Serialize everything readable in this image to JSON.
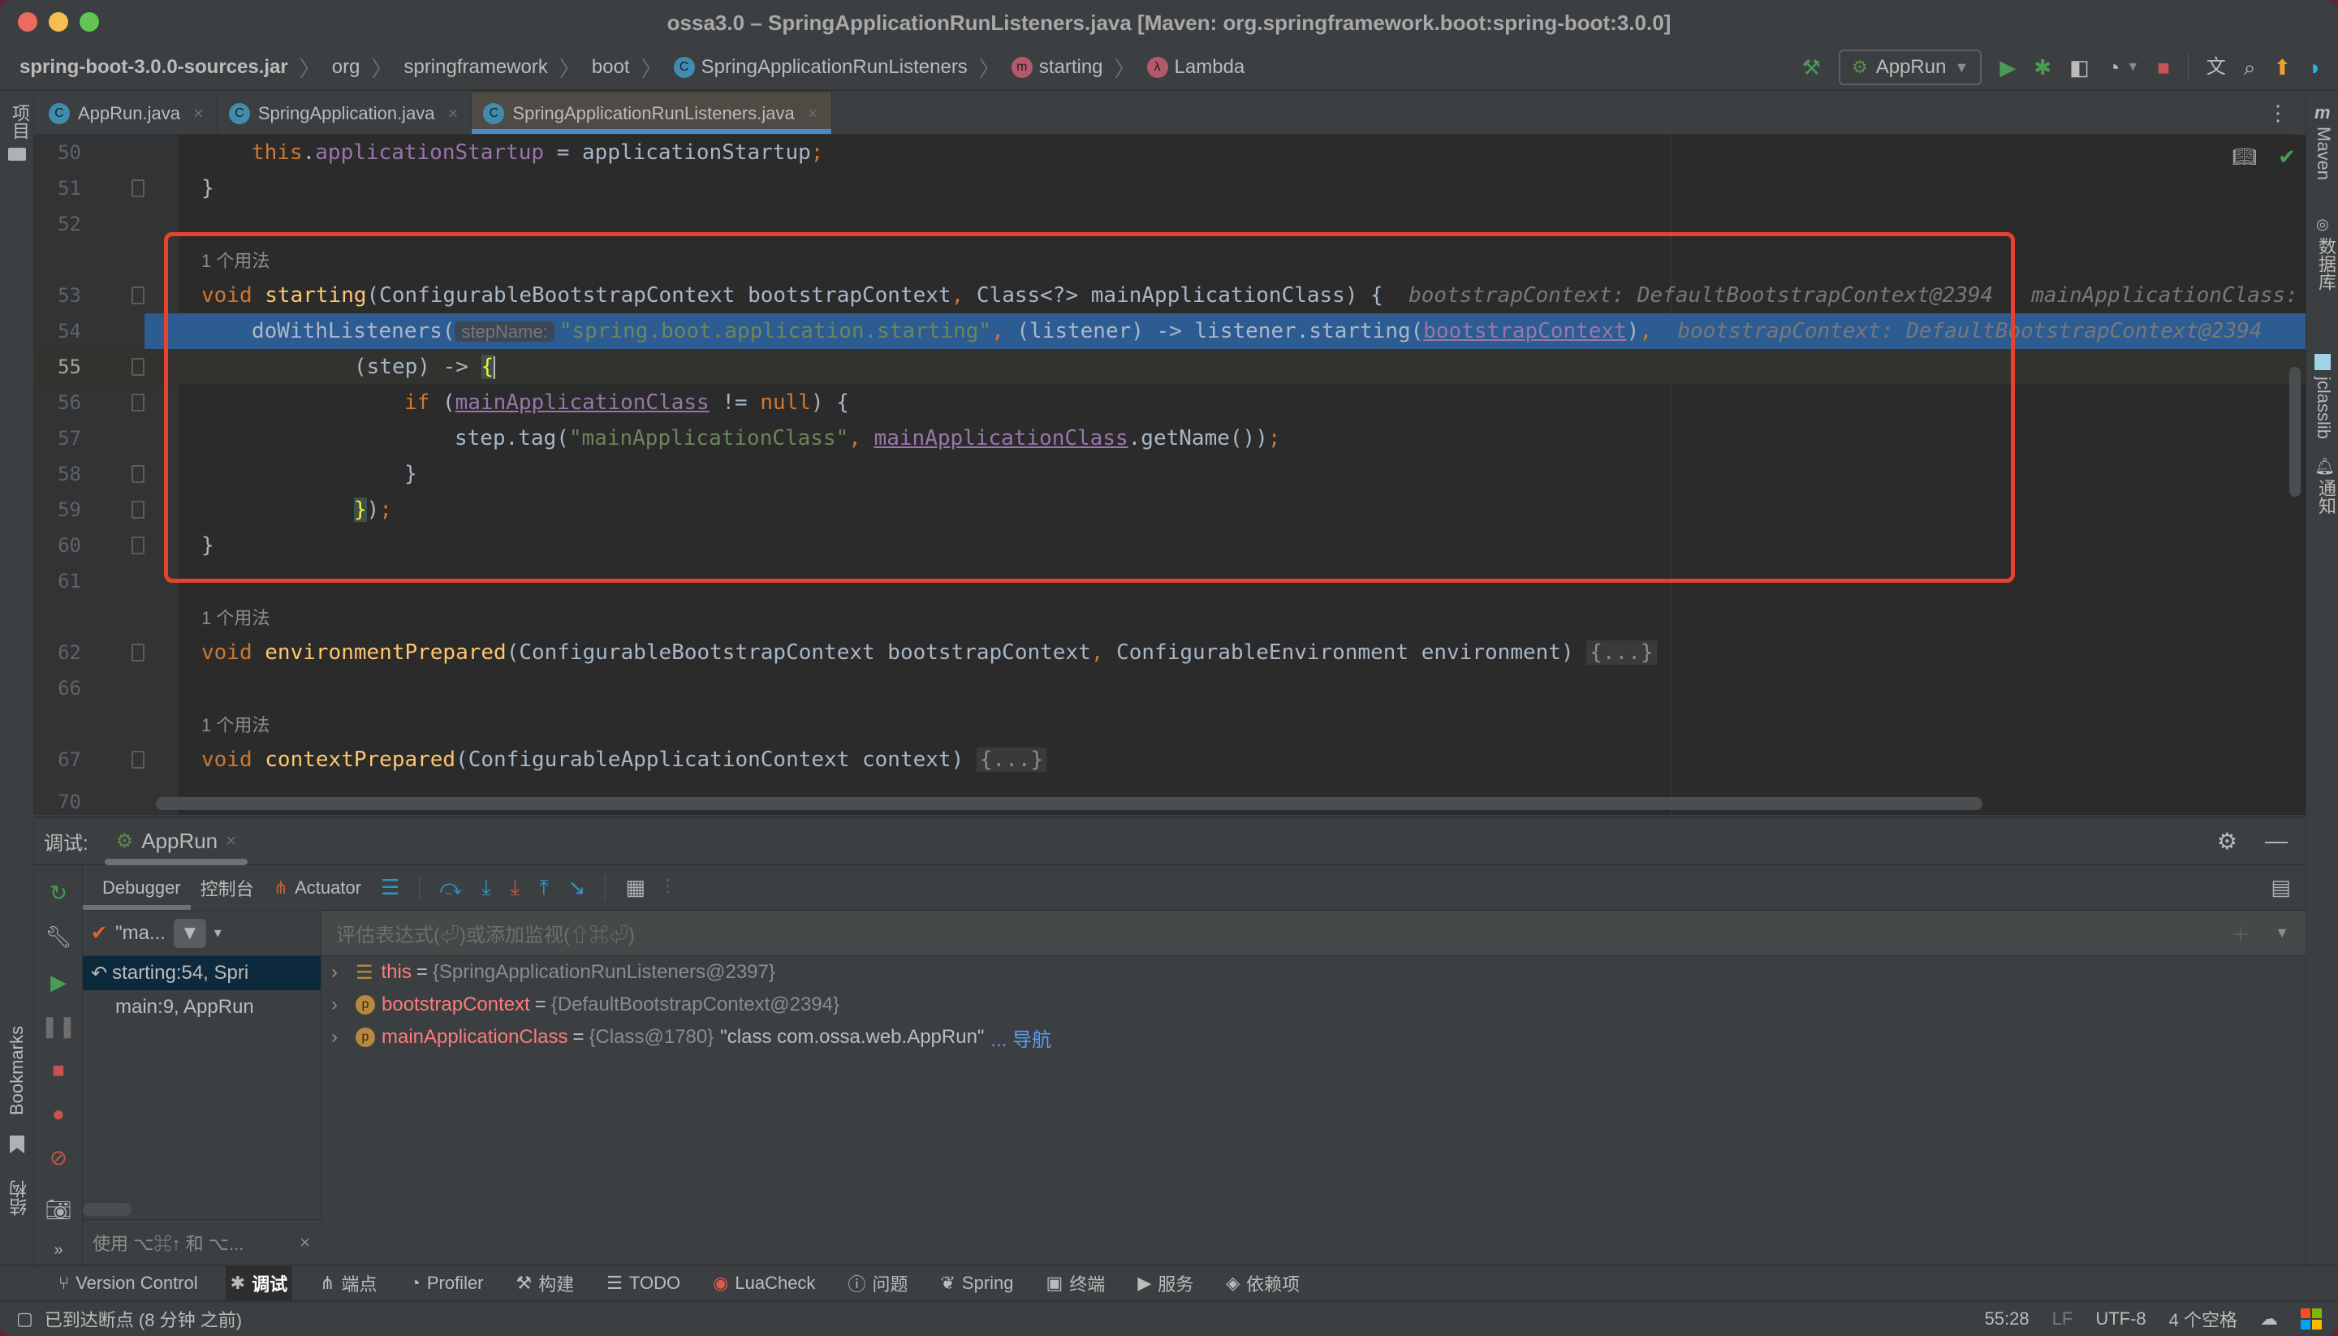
{
  "window": {
    "title": "ossa3.0 – SpringApplicationRunListeners.java [Maven: org.springframework.boot:spring-boot:3.0.0]"
  },
  "breadcrumb": [
    {
      "label": "spring-boot-3.0.0-sources.jar",
      "icon": ""
    },
    {
      "label": "org",
      "icon": ""
    },
    {
      "label": "springframework",
      "icon": ""
    },
    {
      "label": "boot",
      "icon": ""
    },
    {
      "label": "SpringApplicationRunListeners",
      "icon": "C"
    },
    {
      "label": "starting",
      "icon": "m"
    },
    {
      "label": "Lambda",
      "icon": "λ"
    }
  ],
  "toolbar": {
    "run_config": "AppRun",
    "icons": [
      "build-hammer-icon",
      "run-icon",
      "debug-icon",
      "coverage-icon",
      "profile-icon",
      "stop-icon",
      "translate-icon",
      "search-icon",
      "update-icon",
      "plugin-icon"
    ]
  },
  "tabs": [
    {
      "label": "AppRun.java",
      "active": false
    },
    {
      "label": "SpringApplication.java",
      "active": false
    },
    {
      "label": "SpringApplicationRunListeners.java",
      "active": true
    }
  ],
  "left_strip": {
    "project": "项目",
    "bookmarks": "Bookmarks",
    "structure": "结构"
  },
  "right_strip": {
    "maven": "Maven",
    "database": "数据库",
    "jclasslib": "jclasslib",
    "notifications": "通知"
  },
  "editor": {
    "usage_hint": "1 个用法",
    "lines": {
      "l50": {
        "num": "50",
        "a": "this",
        "b": ".",
        "c": "applicationStartup",
        "d": " = applicationStartup",
        "e": ";"
      },
      "l51": {
        "num": "51",
        "text": "}"
      },
      "l52": {
        "num": "52"
      },
      "l53": {
        "num": "53",
        "kw": "void",
        "fn": "starting",
        "p1": "(ConfigurableBootstrapContext bootstrapContext",
        "comma": ",",
        "p2": " Class<?> mainApplicationClass) {",
        "dbg1": "bootstrapContext: DefaultBootstrapContext@2394",
        "dbg2": "mainApplicationClass:"
      },
      "l54": {
        "num": "54",
        "call": "doWithListeners(",
        "inlay": "stepName:",
        "str": "\"spring.boot.application.starting\"",
        "comma": ",",
        "mid": " (listener) -> listener.starting(",
        "arg": "bootstrapContext",
        "close": ")",
        "comma2": ",",
        "dbg": "bootstrapContext: DefaultBootstrapContext@2394"
      },
      "l55": {
        "num": "55",
        "text": "(step) -> ",
        "brace": "{"
      },
      "l56": {
        "num": "56",
        "kw": "if",
        "open": " (",
        "var": "mainApplicationClass",
        "op": " != ",
        "null": "null",
        "close": ") {"
      },
      "l57": {
        "num": "57",
        "a": "step.tag(",
        "str": "\"mainApplicationClass\"",
        "comma": ",",
        "sp": " ",
        "var": "mainApplicationClass",
        "b": ".getName())",
        "semi": ";"
      },
      "l58": {
        "num": "58",
        "text": "}"
      },
      "l59": {
        "num": "59",
        "brace": "}",
        "rest": ")",
        "semi": ";"
      },
      "l60": {
        "num": "60",
        "text": "}"
      },
      "l61": {
        "num": "61"
      },
      "l62": {
        "num": "62",
        "kw": "void",
        "fn": "environmentPrepared",
        "p1": "(ConfigurableBootstrapContext bootstrapContext",
        "comma": ",",
        "p2": " ConfigurableEnvironment environment) ",
        "folded": "{...}"
      },
      "l66": {
        "num": "66"
      },
      "l67": {
        "num": "67",
        "kw": "void",
        "fn": "contextPrepared",
        "p1": "(ConfigurableApplicationContext context) ",
        "folded": "{...}"
      },
      "l70": {
        "num": "70"
      }
    }
  },
  "debug": {
    "label": "调试:",
    "session_tab": "AppRun",
    "tabs": {
      "debugger": "Debugger",
      "console": "控制台",
      "actuator": "Actuator"
    },
    "thread_selector": "\"ma...",
    "eval_placeholder": "评估表达式(⏎)或添加监视(⇧⌘⏎)",
    "frames": [
      {
        "label": "starting:54, Spri",
        "selected": true
      },
      {
        "label": "main:9, AppRun",
        "selected": false
      }
    ],
    "hint": "使用 ⌥⌘↑ 和 ⌥...",
    "variables": [
      {
        "name": "this",
        "value": "{SpringApplicationRunListeners@2397}",
        "icon": "field-icon"
      },
      {
        "name": "bootstrapContext",
        "value": "{DefaultBootstrapContext@2394}",
        "icon": "p"
      },
      {
        "name": "mainApplicationClass",
        "value": "{Class@1780}",
        "string": "\"class com.ossa.web.AppRun\"",
        "link": "... 导航",
        "icon": "p"
      }
    ]
  },
  "bottom_tools": [
    {
      "label": "Version Control",
      "active": false
    },
    {
      "label": "调试",
      "active": true
    },
    {
      "label": "端点",
      "active": false
    },
    {
      "label": "Profiler",
      "active": false
    },
    {
      "label": "构建",
      "active": false
    },
    {
      "label": "TODO",
      "active": false
    },
    {
      "label": "LuaCheck",
      "active": false
    },
    {
      "label": "问题",
      "active": false
    },
    {
      "label": "Spring",
      "active": false
    },
    {
      "label": "终端",
      "active": false
    },
    {
      "label": "服务",
      "active": false
    },
    {
      "label": "依赖项",
      "active": false
    }
  ],
  "status": {
    "message": "已到达断点 (8 分钟 之前)",
    "position": "55:28",
    "line_ending": "LF",
    "encoding": "UTF-8",
    "indent": "4 个空格"
  },
  "colors": {
    "accent": "#4a88c7",
    "highlight": "#2d5c93",
    "annotation": "#e8422e"
  }
}
